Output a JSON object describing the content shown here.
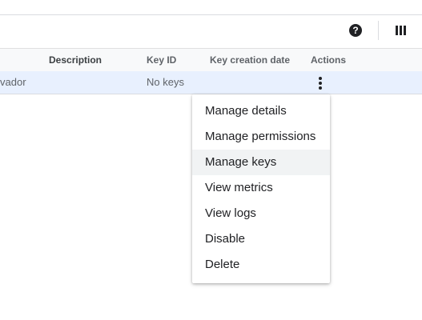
{
  "toolbar": {
    "help_symbol": "?",
    "help_icon": "help-circle-icon",
    "columns_icon": "column-display-icon"
  },
  "table": {
    "headers": [
      "Description",
      "Key ID",
      "Key creation date",
      "Actions"
    ],
    "rows": [
      {
        "name_partial": "vador",
        "description": "",
        "key_id": "No keys",
        "key_creation_date": "",
        "actions_icon": "more-vert-icon"
      }
    ],
    "row_highlight_color": "#e8f0fe"
  },
  "menu": {
    "items": [
      "Manage details",
      "Manage permissions",
      "Manage keys",
      "View metrics",
      "View logs",
      "Disable",
      "Delete"
    ],
    "hovered_item": "Manage keys"
  }
}
